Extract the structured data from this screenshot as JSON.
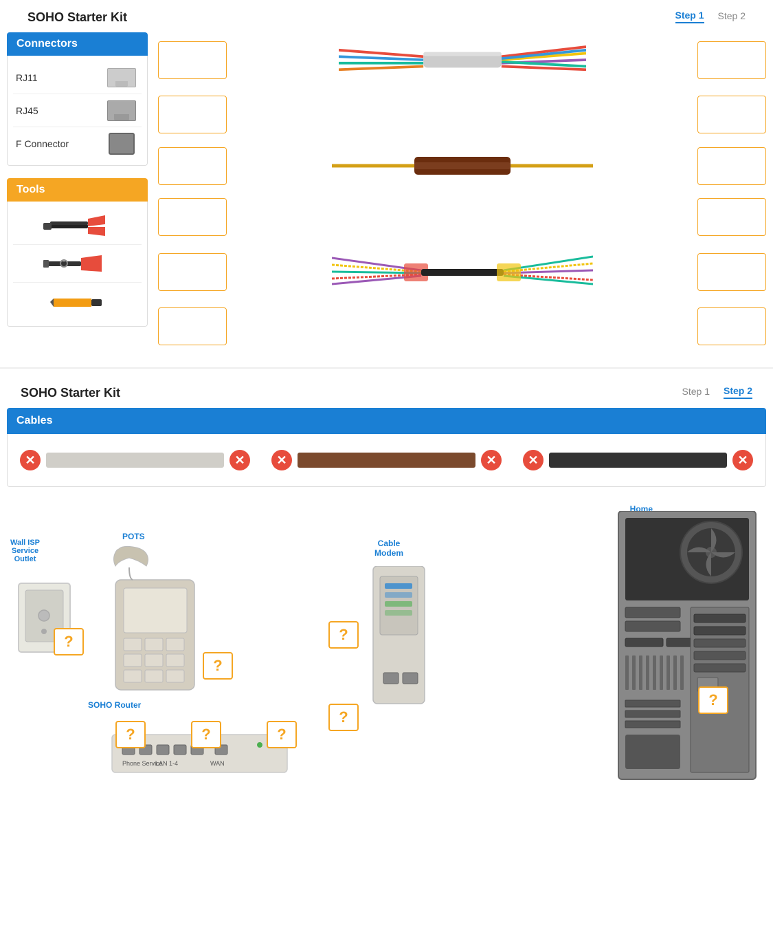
{
  "kit1": {
    "title": "SOHO Starter Kit",
    "step1_label": "Step 1",
    "step2_label": "Step 2",
    "active_step": "step1"
  },
  "connectors_panel": {
    "header": "Connectors",
    "items": [
      {
        "label": "RJ11",
        "type": "rj11"
      },
      {
        "label": "RJ45",
        "type": "rj45"
      },
      {
        "label": "F Connector",
        "type": "fconn"
      }
    ]
  },
  "tools_panel": {
    "header": "Tools",
    "items": [
      {
        "type": "crimper1"
      },
      {
        "type": "crimper2"
      },
      {
        "type": "marker"
      }
    ]
  },
  "kit2": {
    "title": "SOHO Starter Kit",
    "step1_label": "Step 1",
    "step2_label": "Step 2",
    "active_step": "step2"
  },
  "cables_panel": {
    "header": "Cables",
    "items": [
      {
        "type": "white",
        "color": "white_cable"
      },
      {
        "type": "brown",
        "color": "brown_cable"
      },
      {
        "type": "black",
        "color": "black_cable"
      }
    ]
  },
  "network": {
    "labels": {
      "pots": "POTS",
      "home_pc": "Home\nPC",
      "cable_modem": "Cable\nModem",
      "wall_isp": "Wall ISP\nService\nOutlet",
      "soho_router": "SOHO\nRouter"
    },
    "port_labels": {
      "phone_service": "Phone Service",
      "lan_1_4": "LAN 1-4",
      "wan": "WAN"
    }
  }
}
